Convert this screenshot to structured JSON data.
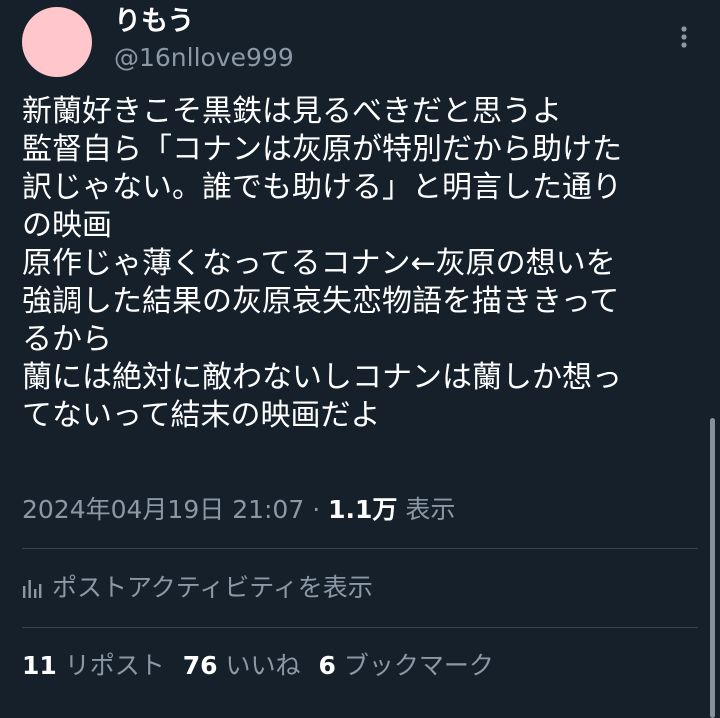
{
  "author": {
    "display_name": "りもう",
    "handle": "@16nllove999",
    "avatar_color": "#ffc6cc"
  },
  "more_icon": "more-vertical-icon",
  "tweet": {
    "lines": [
      "新蘭好きこそ黒鉄は見るべきだと思うよ",
      "監督自ら「コナンは灰原が特別だから助けた",
      "訳じゃない。誰でも助ける」と明言した通り",
      "の映画",
      "原作じゃ薄くなってるコナン←灰原の想いを",
      "強調した結果の灰原哀失恋物語を描ききって",
      "るから",
      "蘭には絶対に敵わないしコナンは蘭しか想っ",
      "てないって結末の映画だよ"
    ]
  },
  "meta": {
    "timestamp": "2024年04月19日 21:07",
    "separator": " · ",
    "views_count": "1.1万",
    "views_label": " 表示"
  },
  "activity": {
    "icon": "analytics-bars-icon",
    "label": "ポストアクティビティを表示"
  },
  "stats": {
    "reposts_count": "11",
    "reposts_label": "リポスト",
    "likes_count": "76",
    "likes_label": "いいね",
    "bookmarks_count": "6",
    "bookmarks_label": "ブックマーク"
  },
  "colors": {
    "background": "#15202b",
    "secondary_text": "#8b98a5",
    "divider": "#38444d"
  }
}
